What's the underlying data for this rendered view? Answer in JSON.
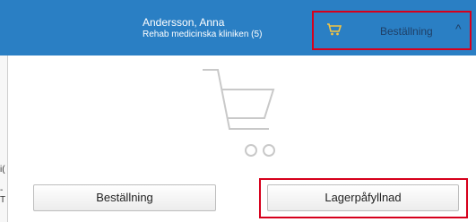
{
  "header": {
    "user_name": "Andersson, Anna",
    "user_unit": "Rehab medicinska kliniken (5)",
    "order_tab": {
      "icon": "cart-icon",
      "label": "Beställning",
      "chevron": "^"
    }
  },
  "left_edge": {
    "fragment_1": "i(",
    "fragment_2": "-T"
  },
  "main": {
    "empty_cart_icon": "empty-cart-icon"
  },
  "actions": {
    "order_label": "Beställning",
    "refill_label": "Lagerpåfyllnad"
  },
  "colors": {
    "header_bg": "#2a7fc4",
    "highlight": "#d6001c"
  }
}
